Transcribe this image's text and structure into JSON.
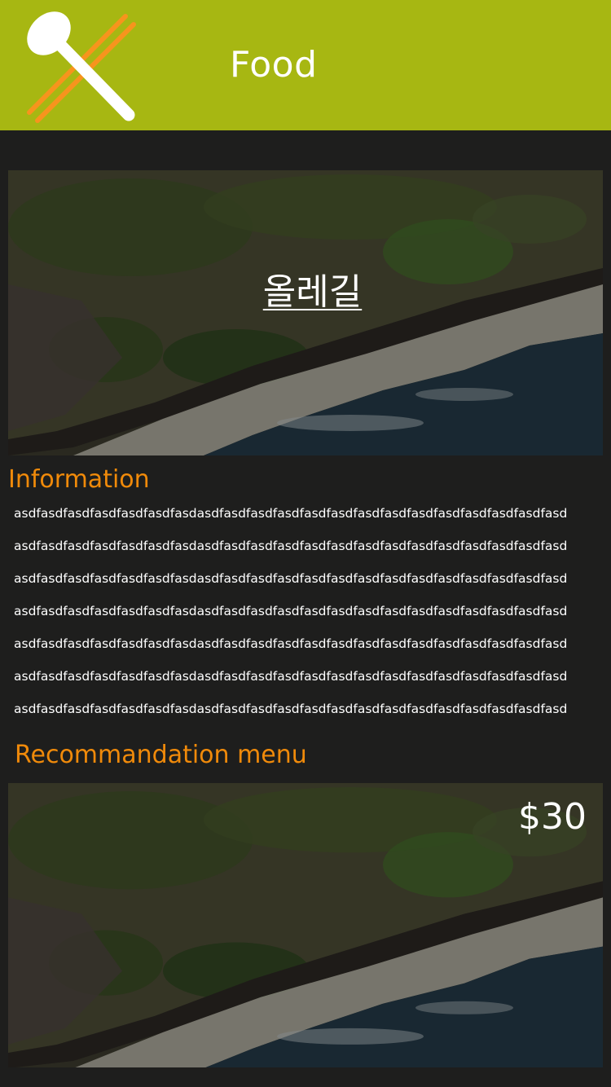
{
  "header": {
    "title": "Food",
    "icon": "spoon-chopsticks-icon",
    "background_color": "#a7b712"
  },
  "hero": {
    "label": "올레길",
    "image": "coastline-aerial-photo"
  },
  "information": {
    "heading": "Information",
    "lines": [
      "asdfasdfasdfasdfasdfasdfasdasdfasdfasdfasdfasdfasdfasdfasdfasdfasdfasdfasdfasdfasd",
      "asdfasdfasdfasdfasdfasdfasdasdfasdfasdfasdfasdfasdfasdfasdfasdfasdfasdfasdfasdfasd",
      "asdfasdfasdfasdfasdfasdfasdasdfasdfasdfasdfasdfasdfasdfasdfasdfasdfasdfasdfasdfasd",
      "asdfasdfasdfasdfasdfasdfasdasdfasdfasdfasdfasdfasdfasdfasdfasdfasdfasdfasdfasdfasd",
      "asdfasdfasdfasdfasdfasdfasdasdfasdfasdfasdfasdfasdfasdfasdfasdfasdfasdfasdfasdfasd",
      "asdfasdfasdfasdfasdfasdfasdasdfasdfasdfasdfasdfasdfasdfasdfasdfasdfasdfasdfasdfasd",
      "asdfasdfasdfasdfasdfasdfasdasdfasdfasdfasdfasdfasdfasdfasdfasdfasdfasdfasdfasdfasd"
    ]
  },
  "recommendation": {
    "heading": "Recommandation menu",
    "price": "$30",
    "image": "coastline-aerial-photo"
  },
  "colors": {
    "accent": "#f08a0a",
    "background": "#1e1e1d",
    "text": "#ffffff"
  }
}
